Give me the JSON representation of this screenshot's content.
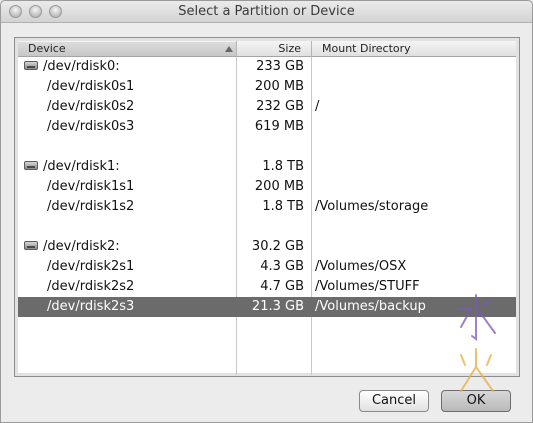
{
  "window": {
    "title": "Select a Partition or Device"
  },
  "table": {
    "columns": {
      "device": "Device",
      "size": "Size",
      "mount": "Mount Directory"
    },
    "rows": [
      {
        "device": "/dev/rdisk0:",
        "size": "233 GB",
        "mount": "",
        "is_disk": true,
        "selected": false
      },
      {
        "device": "/dev/rdisk0s1",
        "size": "200 MB",
        "mount": "",
        "is_disk": false,
        "selected": false
      },
      {
        "device": "/dev/rdisk0s2",
        "size": "232 GB",
        "mount": "/",
        "is_disk": false,
        "selected": false
      },
      {
        "device": "/dev/rdisk0s3",
        "size": "619 MB",
        "mount": "",
        "is_disk": false,
        "selected": false
      },
      {
        "spacer": true
      },
      {
        "device": "/dev/rdisk1:",
        "size": "1.8 TB",
        "mount": "",
        "is_disk": true,
        "selected": false
      },
      {
        "device": "/dev/rdisk1s1",
        "size": "200 MB",
        "mount": "",
        "is_disk": false,
        "selected": false
      },
      {
        "device": "/dev/rdisk1s2",
        "size": "1.8 TB",
        "mount": "/Volumes/storage",
        "is_disk": false,
        "selected": false
      },
      {
        "spacer": true
      },
      {
        "device": "/dev/rdisk2:",
        "size": "30.2 GB",
        "mount": "",
        "is_disk": true,
        "selected": false
      },
      {
        "device": "/dev/rdisk2s1",
        "size": "4.3 GB",
        "mount": "/Volumes/OSX",
        "is_disk": false,
        "selected": false
      },
      {
        "device": "/dev/rdisk2s2",
        "size": "4.7 GB",
        "mount": "/Volumes/STUFF",
        "is_disk": false,
        "selected": false
      },
      {
        "device": "/dev/rdisk2s3",
        "size": "21.3 GB",
        "mount": "/Volumes/backup",
        "is_disk": false,
        "selected": true
      }
    ]
  },
  "buttons": {
    "cancel": "Cancel",
    "ok": "OK"
  },
  "colors": {
    "selection": "#6b6b6b",
    "watermark_top": "#7a5ab8",
    "watermark_bottom": "#e7b24a"
  }
}
